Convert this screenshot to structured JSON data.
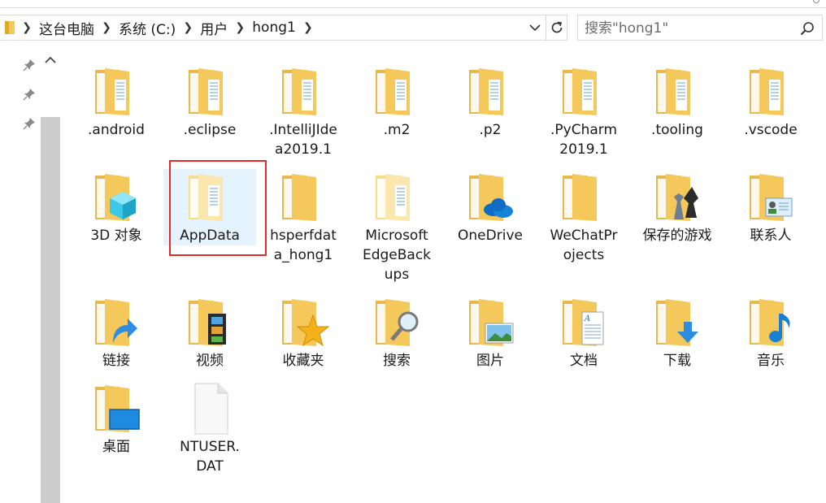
{
  "window": {
    "breadcrumb": [
      "这台电脑",
      "系统 (C:)",
      "用户",
      "hong1"
    ],
    "search_placeholder": "搜索\"hong1\""
  },
  "colors": {
    "folder": "#f5c85b",
    "folder_light": "#fbe29a",
    "selection": "#e5f3ff",
    "highlight": "#e02b2b"
  },
  "items": [
    {
      "label": ".android",
      "icon": "folder-docs-icon"
    },
    {
      "label": ".eclipse",
      "icon": "folder-docs-icon"
    },
    {
      "label": ".IntelliJIdea2019.1",
      "icon": "folder-docs-icon"
    },
    {
      "label": ".m2",
      "icon": "folder-docs-icon"
    },
    {
      "label": ".p2",
      "icon": "folder-docs-icon"
    },
    {
      "label": ".PyCharm2019.1",
      "icon": "folder-docs-icon"
    },
    {
      "label": ".tooling",
      "icon": "folder-docs-icon"
    },
    {
      "label": ".vscode",
      "icon": "folder-docs-icon"
    },
    {
      "label": "3D 对象",
      "icon": "3d-objects-folder-icon"
    },
    {
      "label": "AppData",
      "icon": "hidden-folder-icon"
    },
    {
      "label": "hsperfdata_hong1",
      "icon": "folder-icon"
    },
    {
      "label": "MicrosoftEdgeBackups",
      "icon": "hidden-folder-icon"
    },
    {
      "label": "OneDrive",
      "icon": "onedrive-folder-icon"
    },
    {
      "label": "WeChatProjects",
      "icon": "folder-icon"
    },
    {
      "label": "保存的游戏",
      "icon": "saved-games-folder-icon"
    },
    {
      "label": "联系人",
      "icon": "contacts-folder-icon"
    },
    {
      "label": "链接",
      "icon": "links-folder-icon"
    },
    {
      "label": "视频",
      "icon": "videos-folder-icon"
    },
    {
      "label": "收藏夹",
      "icon": "favorites-folder-icon"
    },
    {
      "label": "搜索",
      "icon": "searches-folder-icon"
    },
    {
      "label": "图片",
      "icon": "pictures-folder-icon"
    },
    {
      "label": "文档",
      "icon": "documents-folder-icon"
    },
    {
      "label": "下载",
      "icon": "downloads-folder-icon"
    },
    {
      "label": "音乐",
      "icon": "music-folder-icon"
    },
    {
      "label": "桌面",
      "icon": "desktop-folder-icon"
    },
    {
      "label": "NTUSER.DAT",
      "icon": "file-icon"
    }
  ]
}
